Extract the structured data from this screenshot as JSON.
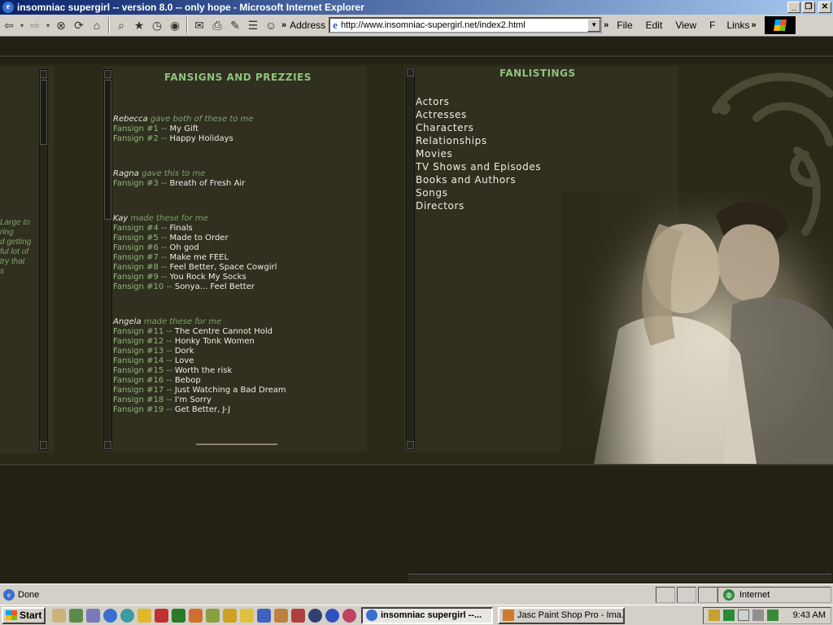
{
  "window": {
    "title": "insomniac supergirl -- version 8.0 -- only hope - Microsoft Internet Explorer"
  },
  "toolbar": {
    "address_label": "Address",
    "url": "http://www.insomniac-supergirl.net/index2.html",
    "menu": [
      "File",
      "Edit",
      "View",
      "F"
    ],
    "links_label": "Links",
    "overflow_chevron": "»"
  },
  "left_panel": {
    "snippet_lines": [
      "Large to",
      "ring",
      "d getting",
      "ful lot of",
      "try that",
      "s"
    ]
  },
  "fansigns": {
    "title": "FANSIGNS AND PREZZIES",
    "groups": [
      {
        "name": "Rebecca",
        "note": " gave both of these to me",
        "items": [
          {
            "label": "Fansign #1",
            "title": "My Gift"
          },
          {
            "label": "Fansign #2",
            "title": "Happy Holidays"
          }
        ]
      },
      {
        "name": "Ragna",
        "note": " gave this to me",
        "items": [
          {
            "label": "Fansign #3",
            "title": "Breath of Fresh Air"
          }
        ]
      },
      {
        "name": "Kay",
        "note": " made these for me",
        "items": [
          {
            "label": "Fansign #4",
            "title": "Finals"
          },
          {
            "label": "Fansign #5",
            "title": "Made to Order"
          },
          {
            "label": "Fansign #6",
            "title": "Oh god"
          },
          {
            "label": "Fansign #7",
            "title": "Make me FEEL"
          },
          {
            "label": "Fansign #8",
            "title": "Feel Better, Space Cowgirl"
          },
          {
            "label": "Fansign #9",
            "title": "You Rock My Socks"
          },
          {
            "label": "Fansign #10",
            "title": "Sonya... Feel Better"
          }
        ]
      },
      {
        "name": "Angela",
        "note": " made these for me",
        "items": [
          {
            "label": "Fansign #11",
            "title": "The Centre Cannot Hold"
          },
          {
            "label": "Fansign #12",
            "title": "Honky Tonk Women"
          },
          {
            "label": "Fansign #13",
            "title": "Dork"
          },
          {
            "label": "Fansign #14",
            "title": "Love"
          },
          {
            "label": "Fansign #15",
            "title": "Worth the risk"
          },
          {
            "label": "Fansign #16",
            "title": "Bebop"
          },
          {
            "label": "Fansign #17",
            "title": "Just Watching a Bad Dream"
          },
          {
            "label": "Fansign #18",
            "title": "I'm Sorry"
          },
          {
            "label": "Fansign #19",
            "title": "Get Better, J-J"
          }
        ]
      }
    ],
    "separator": " -- "
  },
  "fanlistings": {
    "title": "FANLISTINGS",
    "items": [
      "Actors",
      "Actresses",
      "Characters",
      "Relationships",
      "Movies",
      "TV Shows and Episodes",
      "Books and Authors",
      "Songs",
      "Directors"
    ]
  },
  "status": {
    "text": "Done",
    "zone": "Internet"
  },
  "taskbar": {
    "start_label": "Start",
    "tasks": [
      {
        "label": "insomniac supergirl --...",
        "active": true
      },
      {
        "label": "Jasc Paint Shop Pro - Ima...",
        "active": false
      }
    ],
    "clock": "9:43 AM"
  },
  "colors": {
    "page_bg": "#232114",
    "panel_bg": "#302f20",
    "accent_green": "#8fc37d",
    "text_light": "#eeeeea"
  }
}
